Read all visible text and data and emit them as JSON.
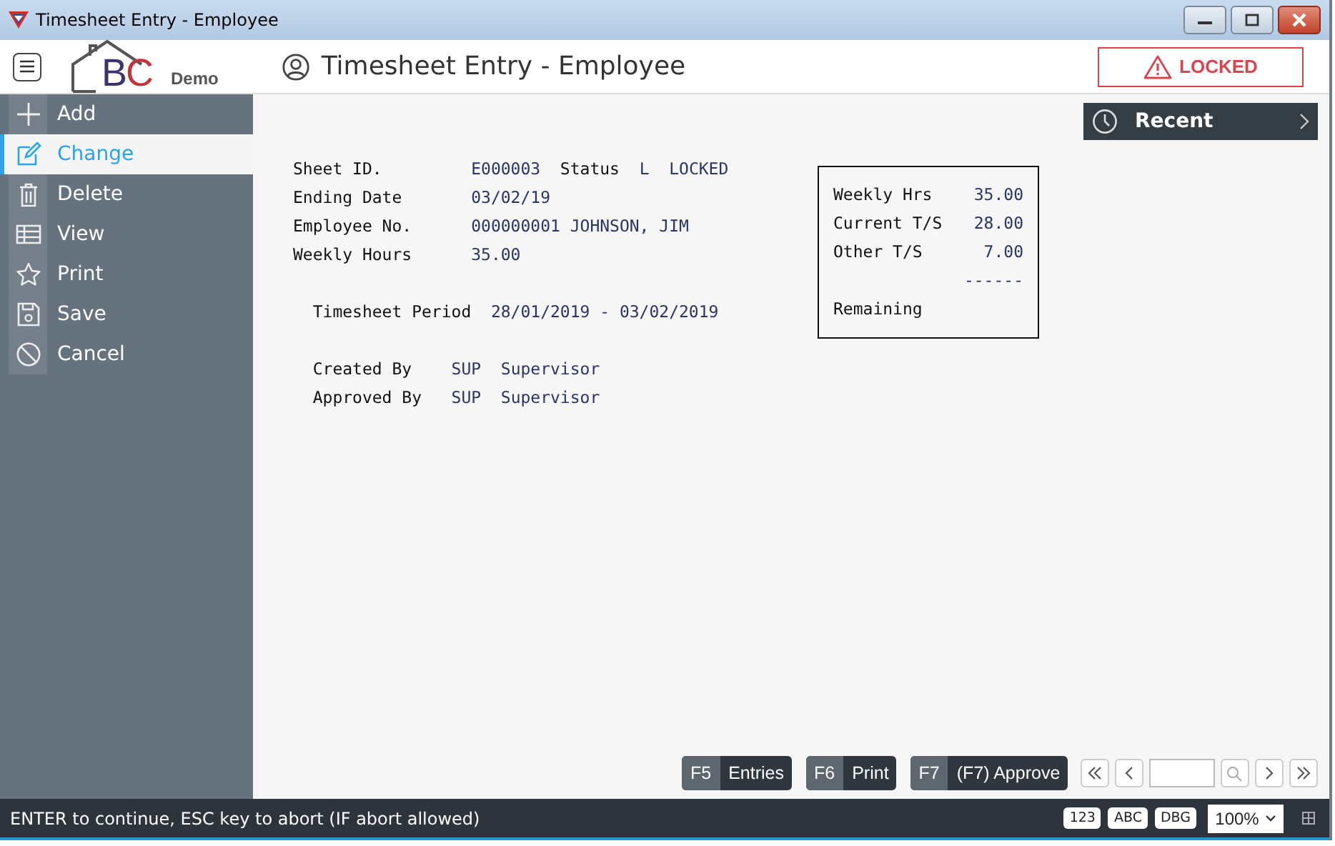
{
  "window": {
    "title": "Timesheet Entry - Employee"
  },
  "header": {
    "logo_letters": [
      {
        "text": "B",
        "color": "#3b3470"
      },
      {
        "text": "C",
        "color": "#c4323c"
      }
    ],
    "logo_caption": "Demo",
    "title": "Timesheet Entry - Employee",
    "status_badge": "LOCKED"
  },
  "sidebar": {
    "items": [
      {
        "kind": "plus",
        "label": "Add",
        "selected": false
      },
      {
        "kind": "edit",
        "label": "Change",
        "selected": true
      },
      {
        "kind": "trash",
        "label": "Delete",
        "selected": false
      },
      {
        "kind": "table",
        "label": "View",
        "selected": false
      },
      {
        "kind": "star",
        "label": "Print",
        "selected": false
      },
      {
        "kind": "save",
        "label": "Save",
        "selected": false
      },
      {
        "kind": "ban",
        "label": "Cancel",
        "selected": false
      }
    ]
  },
  "recent": {
    "label": "Recent"
  },
  "form": {
    "sections": [
      {
        "kind": "main",
        "rows": [
          [
            {
              "kind": "label",
              "text": "Sheet ID."
            },
            {
              "kind": "value",
              "text": "E000003"
            },
            {
              "kind": "label",
              "text": "Status"
            },
            {
              "kind": "value",
              "text": "L"
            },
            {
              "kind": "value",
              "text": "LOCKED"
            }
          ],
          [
            {
              "kind": "label",
              "text": "Ending Date"
            },
            {
              "kind": "value",
              "text": "03/02/19"
            }
          ],
          [
            {
              "kind": "label",
              "text": "Employee No."
            },
            {
              "kind": "value",
              "text": "000000001 JOHNSON, JIM"
            }
          ],
          [
            {
              "kind": "label",
              "text": "Weekly Hours"
            },
            {
              "kind": "value",
              "text": "35.00"
            }
          ]
        ]
      },
      {
        "kind": "period",
        "rows": [
          [
            {
              "kind": "label",
              "text": "Timesheet Period"
            },
            {
              "kind": "value",
              "text": "28/01/2019 - 03/02/2019"
            }
          ]
        ]
      },
      {
        "kind": "audit",
        "rows": [
          [
            {
              "kind": "label",
              "text": "Created By"
            },
            {
              "kind": "value",
              "text": "SUP"
            },
            {
              "kind": "value",
              "text": "Supervisor"
            }
          ],
          [
            {
              "kind": "label",
              "text": "Approved By"
            },
            {
              "kind": "value",
              "text": "SUP"
            },
            {
              "kind": "value",
              "text": "Supervisor"
            }
          ]
        ]
      }
    ]
  },
  "summary": {
    "rows": [
      {
        "label": "Weekly Hrs",
        "value": "35.00"
      },
      {
        "label": "Current T/S",
        "value": "28.00"
      },
      {
        "label": "Other T/S",
        "value": "7.00"
      },
      {
        "value": "------"
      },
      {
        "label": "Remaining"
      }
    ]
  },
  "function_keys": [
    {
      "key": "F5",
      "label": "Entries"
    },
    {
      "key": "F6",
      "label": "Print"
    },
    {
      "key": "F7",
      "label": "(F7) Approve"
    }
  ],
  "status_bar": {
    "message": "ENTER to continue, ESC key to abort (IF abort allowed)",
    "toggles": [
      "123",
      "ABC",
      "DBG"
    ],
    "zoom": "100%"
  }
}
